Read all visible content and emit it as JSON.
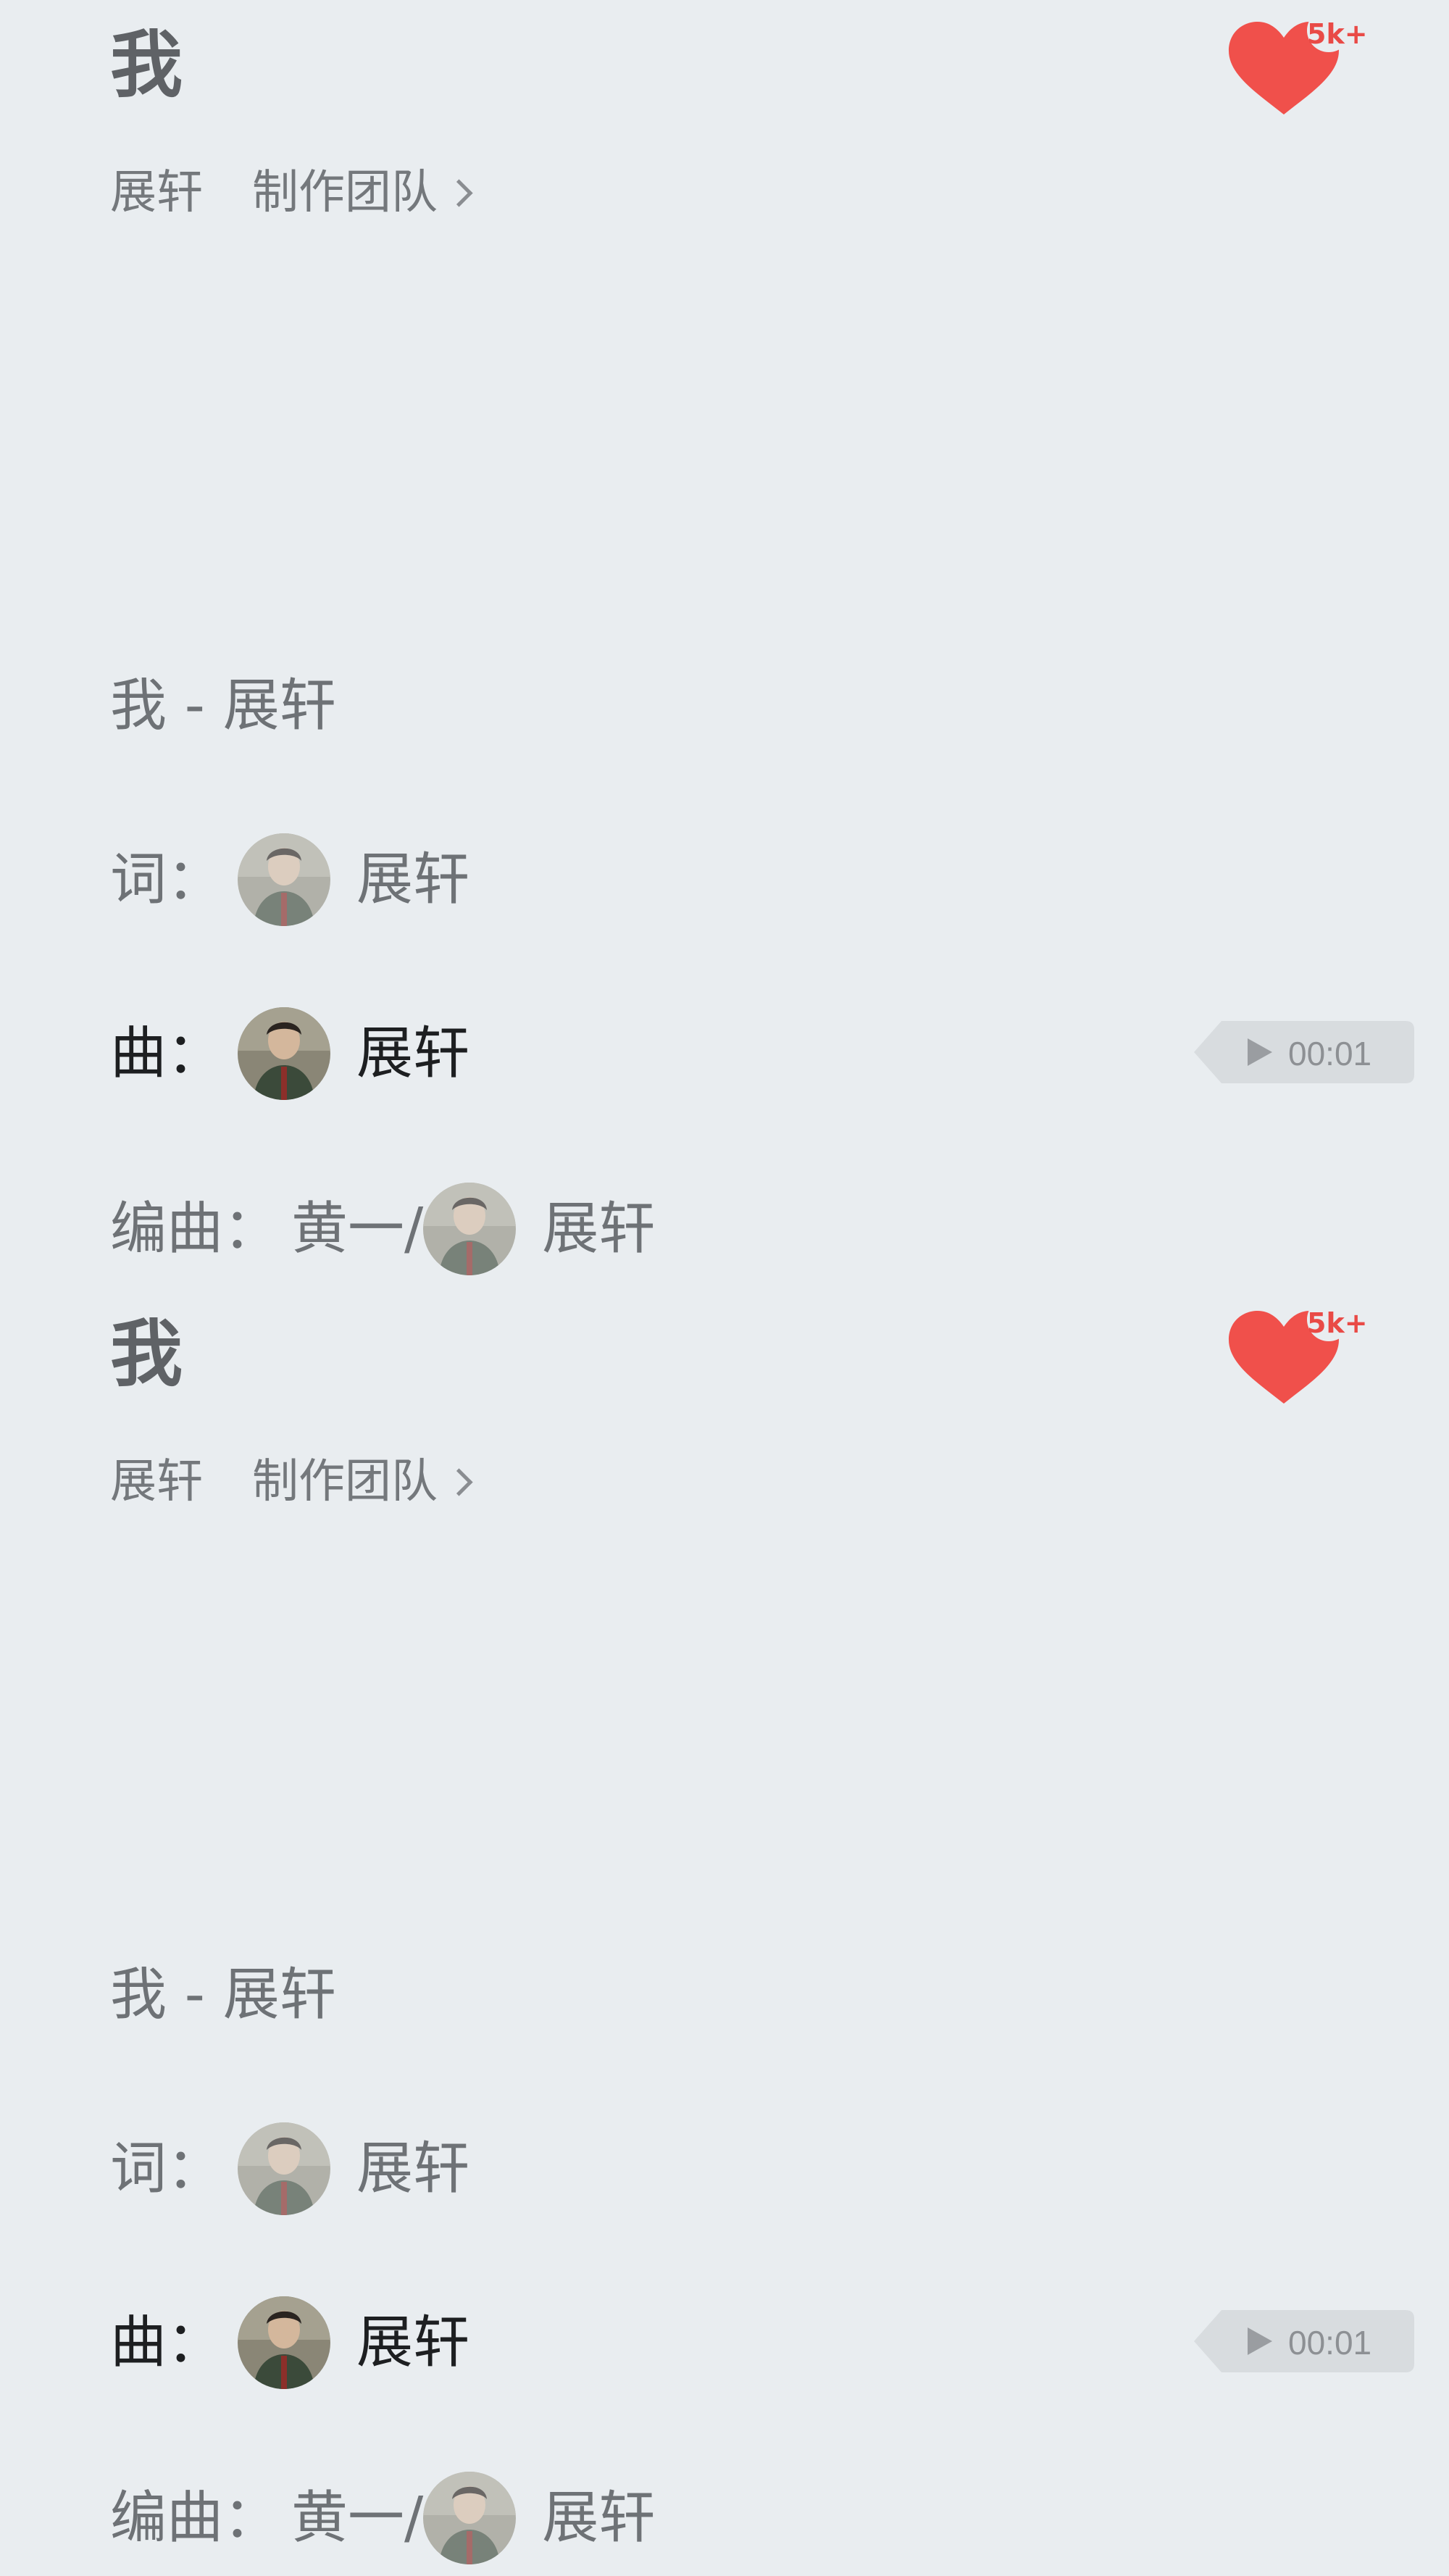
{
  "panels": [
    {
      "title": "我",
      "artist": "展轩",
      "team_link": "制作团队",
      "like_count": "5k+",
      "credit_title": "我 - 展轩",
      "lyricist_label": "词：",
      "lyricist_name": "展轩",
      "composer_label": "曲：",
      "composer_name": "展轩",
      "audio_time": "00:01",
      "arranger_label": "编曲：",
      "arranger_name_1": "黄一/",
      "arranger_name_2": "展轩"
    },
    {
      "title": "我",
      "artist": "展轩",
      "team_link": "制作团队",
      "like_count": "5k+",
      "credit_title": "我 - 展轩",
      "lyricist_label": "词：",
      "lyricist_name": "展轩",
      "composer_label": "曲：",
      "composer_name": "展轩",
      "audio_time": "00:01",
      "arranger_label": "编曲：",
      "arranger_name_1": "黄一/",
      "arranger_name_2": "展轩"
    }
  ],
  "icons": {
    "like": "heart-icon",
    "team_arrow": "chevron-right-icon",
    "play": "play-icon",
    "avatar": "avatar"
  },
  "colors": {
    "background": "#e9edf0",
    "heart": "#f0504b",
    "like_count": "#e94a46",
    "primary_text": "#1d1f21",
    "secondary_text": "#6e7276",
    "audio_chip": "#d8dcdf"
  }
}
